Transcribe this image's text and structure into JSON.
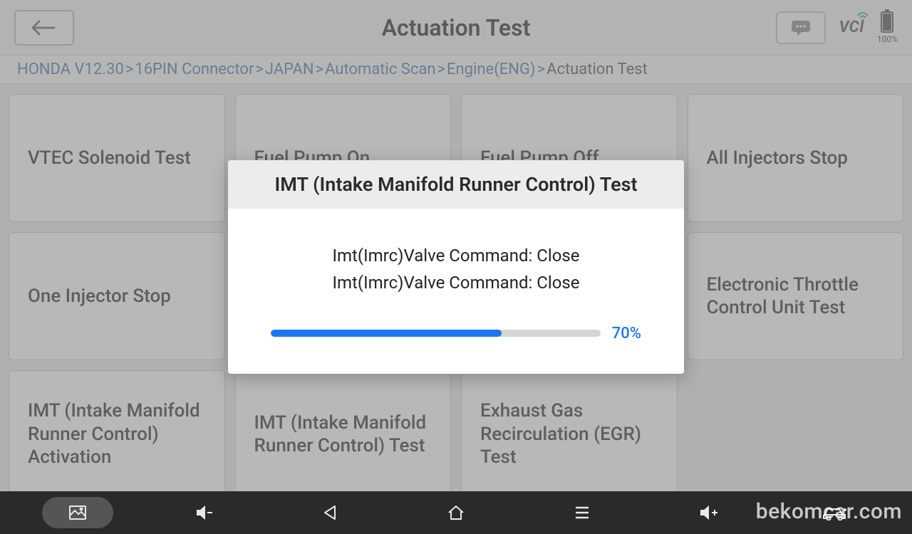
{
  "header": {
    "title": "Actuation Test",
    "battery_text": "100%",
    "vci_label": "VCI"
  },
  "breadcrumb": {
    "items": [
      "HONDA V12.30",
      "16PIN Connector",
      "JAPAN",
      "Automatic Scan",
      "Engine(ENG)"
    ],
    "current": "Actuation Test"
  },
  "cards": [
    "VTEC Solenoid Test",
    "Fuel Pump On",
    "Fuel Pump Off",
    "All Injectors Stop",
    "One Injector Stop",
    "",
    "",
    "Electronic Throttle Control Unit Test",
    "IMT (Intake Manifold Runner Control) Activation",
    "IMT (Intake Manifold Runner Control) Test",
    "Exhaust Gas Recirculation (EGR) Test"
  ],
  "modal": {
    "title": "IMT (Intake Manifold Runner Control) Test",
    "lines": [
      "Imt(Imrc)Valve Command: Close",
      "Imt(Imrc)Valve Command: Close"
    ],
    "progress_pct": 70,
    "progress_label": "70%"
  },
  "watermark": "bekomcar.com"
}
